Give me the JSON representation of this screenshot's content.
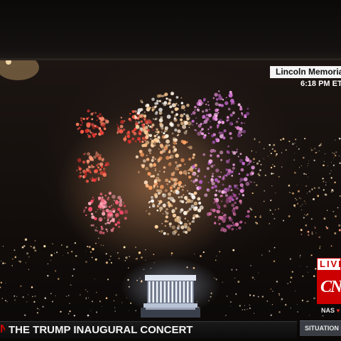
{
  "broadcast": {
    "location": "Lincoln Memorial",
    "time": "6:18 PM ET",
    "live_label": "LIVE",
    "network_logo": "CNN",
    "ticker_symbol": "NAS",
    "ticker_direction": "down-arrow-icon",
    "lower_third_logo_fragment": "N",
    "lower_third_title": "THE TRUMP INAUGURAL CONCERT",
    "situation_label": "SITUATION ROOM"
  },
  "colors": {
    "cnn_red": "#cc0000",
    "lower_third_bg": "#111111",
    "location_bug_bg": "#f4f4f4"
  }
}
